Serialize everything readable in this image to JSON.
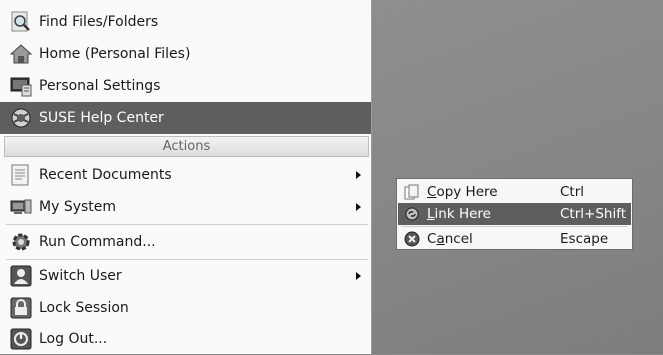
{
  "menu": {
    "items": [
      {
        "label": "Find Files/Folders",
        "icon": "search-icon"
      },
      {
        "label": "Home (Personal Files)",
        "icon": "home-icon"
      },
      {
        "label": "Personal Settings",
        "icon": "settings-icon"
      },
      {
        "label": "SUSE Help Center",
        "icon": "help-icon"
      }
    ],
    "section_header": "Actions",
    "actions": [
      {
        "label": "Recent Documents",
        "icon": "documents-icon",
        "submenu": true
      },
      {
        "label": "My System",
        "icon": "computer-icon",
        "submenu": true
      },
      {
        "label": "Run Command...",
        "icon": "run-command-icon",
        "submenu": false
      },
      {
        "label": "Switch User",
        "icon": "user-icon",
        "submenu": true
      },
      {
        "label": "Lock Session",
        "icon": "lock-icon",
        "submenu": false
      },
      {
        "label": "Log Out...",
        "icon": "logout-icon",
        "submenu": false
      }
    ]
  },
  "context_menu": {
    "items": [
      {
        "mnemonic": "C",
        "rest": "opy Here",
        "shortcut": "Ctrl",
        "icon": "copy-icon"
      },
      {
        "mnemonic": "L",
        "rest": "ink Here",
        "shortcut": "Ctrl+Shift",
        "icon": "link-icon"
      },
      {
        "pre": "C",
        "mnemonic": "a",
        "rest": "ncel",
        "shortcut": "Escape",
        "icon": "cancel-icon"
      }
    ]
  },
  "colors": {
    "selection": "#5e5e5e",
    "desktop": "#8a8a8a",
    "menu_bg": "#fafafa"
  }
}
